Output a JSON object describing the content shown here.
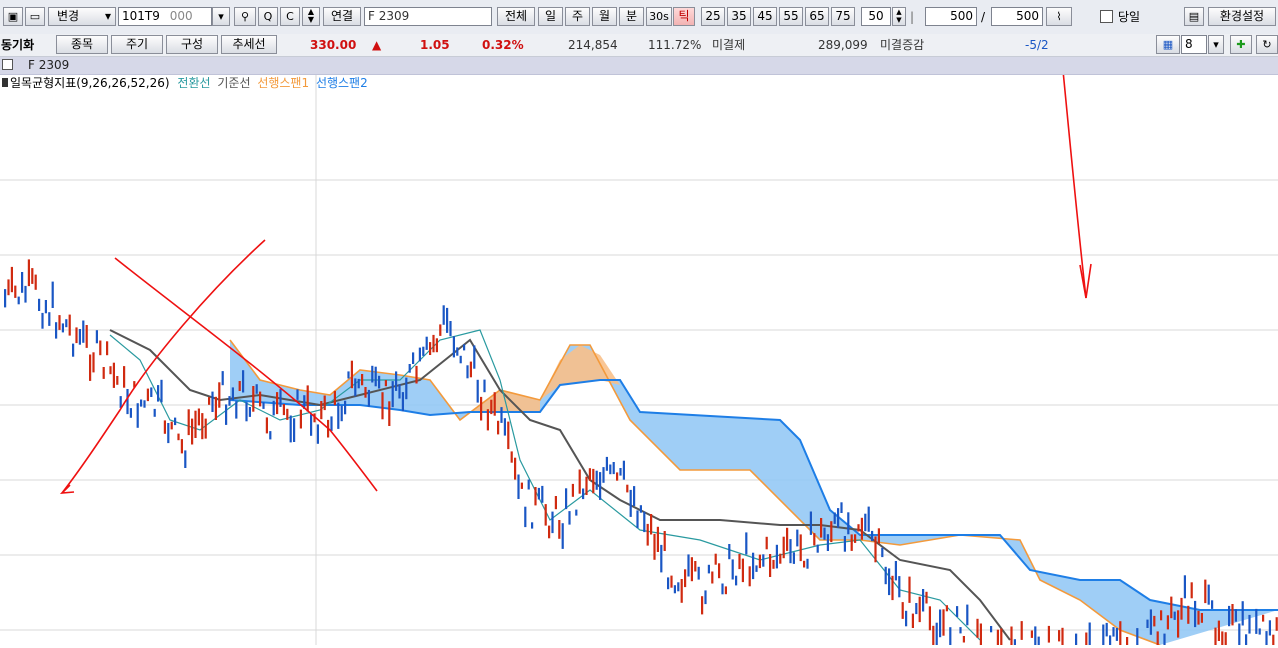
{
  "toolbar": {
    "change_label": "변경",
    "code_value": "101T9",
    "code_suffix": "000",
    "connect_label": "연결",
    "symbol_value": "F 2309",
    "period_buttons": [
      "전체",
      "일",
      "주",
      "월",
      "분",
      "30s",
      "틱"
    ],
    "active_period": "틱",
    "tick_buttons": [
      "25",
      "35",
      "45",
      "55",
      "65",
      "75"
    ],
    "tick_count": "50",
    "display_count": "500",
    "separator": "/",
    "total_count": "500",
    "today_label": "당일",
    "settings_label": "환경설정"
  },
  "quote": {
    "sync_label": "동기화",
    "buttons": [
      "종목",
      "주기",
      "구성",
      "추세선"
    ],
    "price": "330.00",
    "change_arrow": "▲",
    "change": "1.05",
    "change_rate": "0.32%",
    "volume": "214,854",
    "volume_ratio": "111.72%",
    "open_interest_label": "미결제",
    "open_interest": "289,099",
    "oi_change_label": "미결증감",
    "oi_change": "-5/2",
    "grid_count": "8"
  },
  "chart": {
    "symbol_label": "F 2309",
    "indicator_label": "일목균형지표(9,26,26,52,26)",
    "legend": [
      {
        "label": "전환선",
        "color": "#2a9aa0"
      },
      {
        "label": "기준선",
        "color": "#555555"
      },
      {
        "label": "선행스팬1",
        "color": "#f39a3c"
      },
      {
        "label": "선행스팬2",
        "color": "#1e7ee6"
      }
    ],
    "colors": {
      "up_candle": "#d02a10",
      "down_candle": "#1a56c4",
      "kumo_bull": "#f8c08a",
      "kumo_bear": "#8ec6f5",
      "annotation": "#ee1111",
      "grid": "#d9d9d9"
    }
  },
  "chart_data": {
    "type": "candlestick",
    "series": [
      {
        "name": "전환선"
      },
      {
        "name": "기준선"
      },
      {
        "name": "선행스팬1"
      },
      {
        "name": "선행스팬2"
      }
    ],
    "grid": true
  }
}
